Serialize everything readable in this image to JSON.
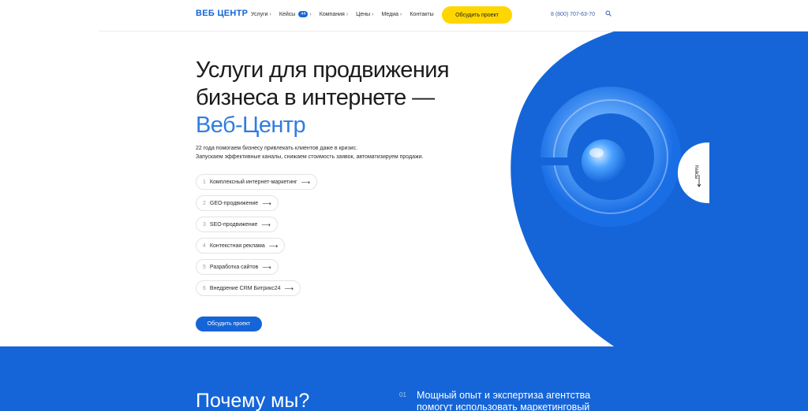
{
  "header": {
    "logo": "ВЕБ ЦЕНТР",
    "nav": [
      {
        "label": "Услуги",
        "chevron": "›"
      },
      {
        "label": "Кейсы",
        "badge": "44",
        "chevron": "›"
      },
      {
        "label": "Компания",
        "chevron": "›"
      },
      {
        "label": "Цены",
        "chevron": "›"
      },
      {
        "label": "Медиа",
        "chevron": "›"
      },
      {
        "label": "Контакты"
      }
    ],
    "cta": "Обсудить проект",
    "phone": "8 (800) 707-63-70",
    "search_icon": "search-icon"
  },
  "hero": {
    "title_line1": "Услуги для продвижения",
    "title_line2": "бизнеса в интернете —",
    "title_accent": "Веб-Центр",
    "subtitle_line1": "22 года помогаем бизнесу привлекать клиентов даже в кризис.",
    "subtitle_line2": "Запускаем эффективные каналы, снижаем стоимость заявок, автоматизируем продажи.",
    "services": [
      {
        "num": "1",
        "label": "Комплексный интернет-маркетинг"
      },
      {
        "num": "2",
        "label": "GEO-продвижение"
      },
      {
        "num": "3",
        "label": "SEO-продвижение"
      },
      {
        "num": "4",
        "label": "Контекстная реклама"
      },
      {
        "num": "5",
        "label": "Разработка сайтов"
      },
      {
        "num": "6",
        "label": "Внедрение CRM Битрикс24"
      }
    ],
    "arrow": "⟶",
    "cta": "Обсудить проект",
    "cases_tab": "Кейсы"
  },
  "why": {
    "title": "Почему мы?",
    "item_num": "01",
    "item_text": "Мощный опыт и экспертиза агентства помогут использовать маркетинговый"
  },
  "colors": {
    "brand_blue": "#1565d8",
    "accent_yellow": "#ffd600",
    "accent_text": "#2f7de0"
  }
}
